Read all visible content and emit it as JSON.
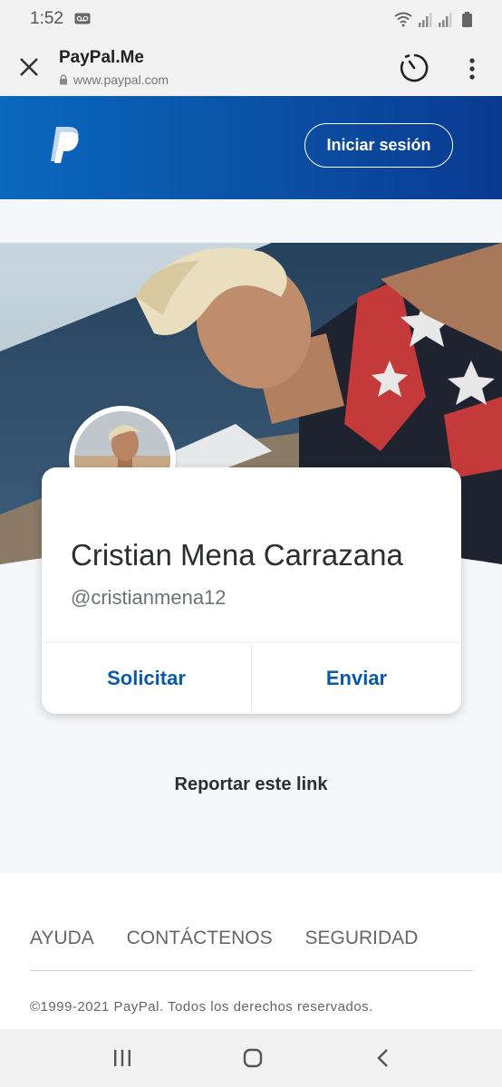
{
  "status_bar": {
    "time": "1:52"
  },
  "browser": {
    "title": "PayPal.Me",
    "url": "www.paypal.com"
  },
  "header": {
    "login_label": "Iniciar sesión"
  },
  "profile": {
    "name": "Cristian Mena Carrazana",
    "handle": "@cristianmena12",
    "request_label": "Solicitar",
    "send_label": "Enviar"
  },
  "report_label": "Reportar este link",
  "footer": {
    "links": [
      "AYUDA",
      "CONTÁCTENOS",
      "SEGURIDAD"
    ],
    "copyright": "©1999-2021 PayPal. Todos los derechos reservados."
  },
  "colors": {
    "brand_blue": "#0a5aa6",
    "header_start": "#0a68bd",
    "header_end": "#093a90"
  }
}
